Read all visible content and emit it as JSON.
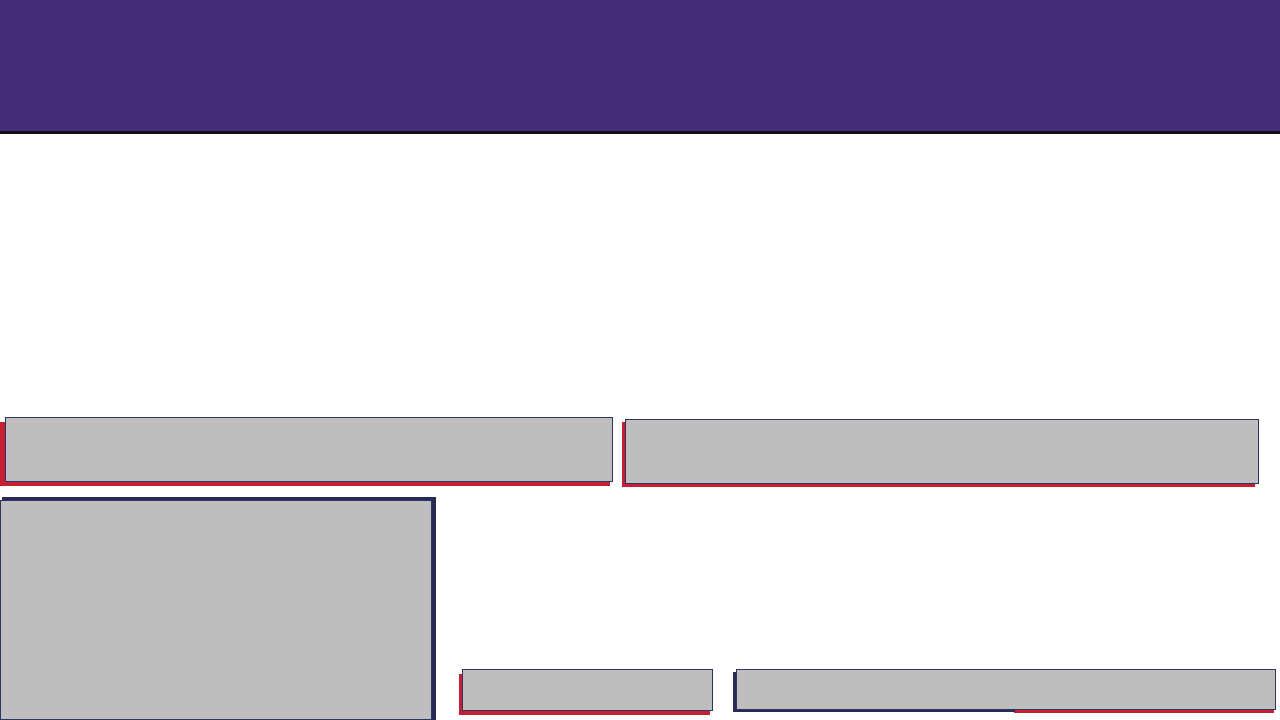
{
  "header": {
    "title": "",
    "background_color": "#432c78"
  },
  "panels": {
    "top_left": {
      "label": ""
    },
    "top_right": {
      "label": ""
    },
    "large_left": {
      "label": ""
    },
    "bottom_middle": {
      "label": ""
    },
    "bottom_right": {
      "label": ""
    }
  },
  "colors": {
    "panel_fill": "#bebebe",
    "panel_border": "#2d3560",
    "accent_red": "#c61f34",
    "accent_navy": "#272a55"
  }
}
